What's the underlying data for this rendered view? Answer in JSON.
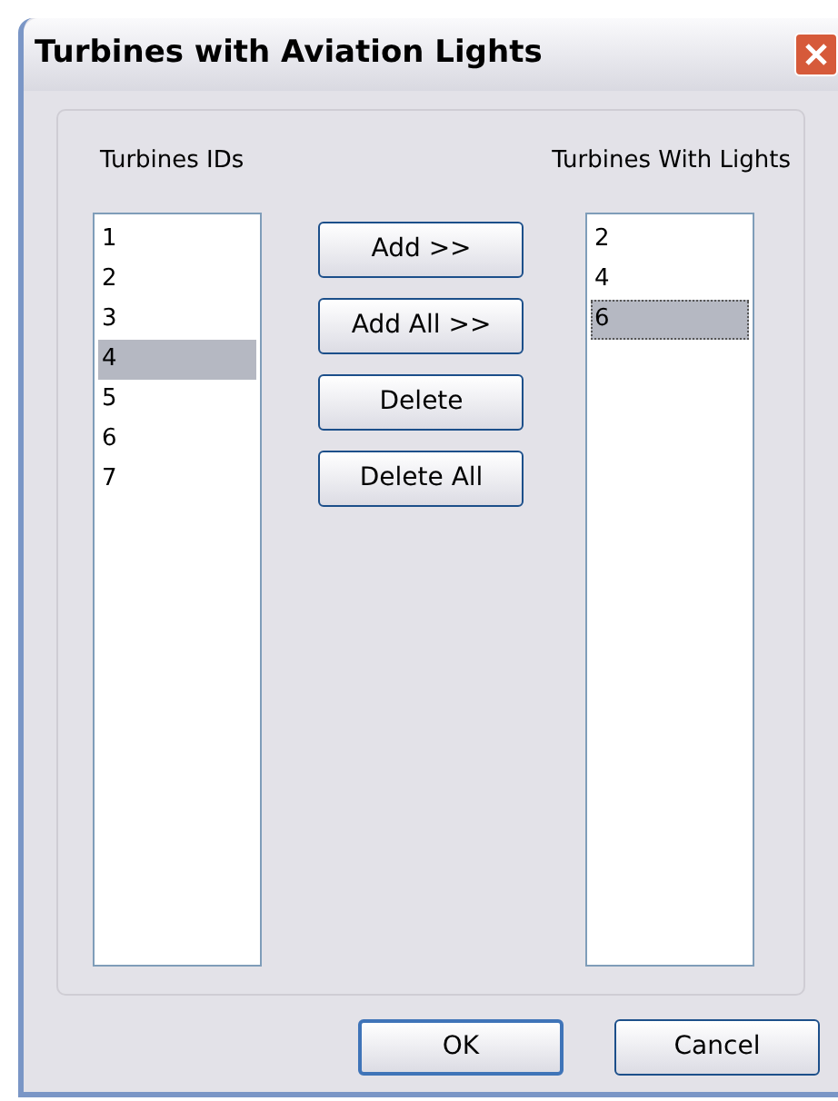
{
  "window": {
    "title": "Turbines with Aviation Lights"
  },
  "left_list": {
    "label": "Turbines IDs",
    "items": [
      {
        "text": "1",
        "selected": false
      },
      {
        "text": "2",
        "selected": false
      },
      {
        "text": "3",
        "selected": false
      },
      {
        "text": "4",
        "selected": true
      },
      {
        "text": "5",
        "selected": false
      },
      {
        "text": "6",
        "selected": false
      },
      {
        "text": "7",
        "selected": false
      }
    ]
  },
  "buttons": [
    "Add >>",
    "Add All >>",
    "Delete",
    "Delete All"
  ],
  "right_list": {
    "label": "Turbines With Lights",
    "items": [
      {
        "text": "2",
        "selected": false,
        "focused": false
      },
      {
        "text": "4",
        "selected": false,
        "focused": false
      },
      {
        "text": "6",
        "selected": true,
        "focused": true
      }
    ]
  },
  "footer_buttons": [
    {
      "label": "OK",
      "default": true
    },
    {
      "label": "Cancel",
      "default": false
    }
  ]
}
